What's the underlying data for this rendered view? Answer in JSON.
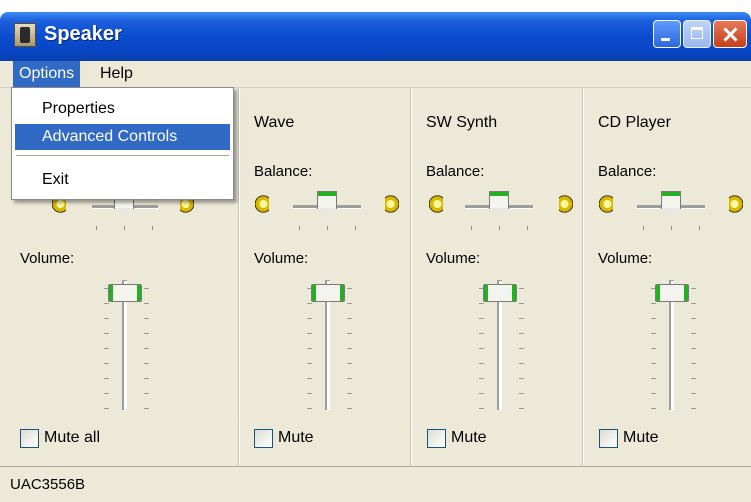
{
  "window": {
    "title": "Speaker"
  },
  "menubar": {
    "items": [
      {
        "label": "Options"
      },
      {
        "label": "Help"
      }
    ]
  },
  "options_menu": {
    "items": [
      {
        "label": "Properties"
      },
      {
        "label": "Advanced Controls"
      },
      {
        "label": "Exit"
      }
    ]
  },
  "channels": [
    {
      "title": "",
      "balance_label": "",
      "volume_label": "Volume:",
      "mute_label": "Mute all",
      "balance": 0.5,
      "volume": 1.0,
      "muted": false
    },
    {
      "title": "Wave",
      "balance_label": "Balance:",
      "volume_label": "Volume:",
      "mute_label": "Mute",
      "balance": 0.5,
      "volume": 1.0,
      "muted": false
    },
    {
      "title": "SW Synth",
      "balance_label": "Balance:",
      "volume_label": "Volume:",
      "mute_label": "Mute",
      "balance": 0.5,
      "volume": 1.0,
      "muted": false
    },
    {
      "title": "CD Player",
      "balance_label": "Balance:",
      "volume_label": "Volume:",
      "mute_label": "Mute",
      "balance": 0.5,
      "volume": 1.0,
      "muted": false
    }
  ],
  "statusbar": {
    "text": "UAC3556B"
  },
  "icons": [
    "app-speaker-icon",
    "minimize-icon",
    "maximize-icon",
    "close-icon",
    "speaker-left-icon",
    "speaker-right-icon"
  ]
}
